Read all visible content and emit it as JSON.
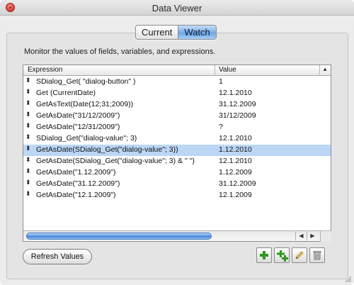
{
  "window": {
    "title": "Data Viewer"
  },
  "tabs": [
    {
      "label": "Current",
      "active": false
    },
    {
      "label": "Watch",
      "active": true
    }
  ],
  "description": "Monitor the values of fields, variables, and expressions.",
  "table": {
    "columns": [
      "Expression",
      "Value"
    ],
    "rows": [
      {
        "expression": "SDialog_Get( \"dialog-button\" )",
        "value": "1"
      },
      {
        "expression": "Get (CurrentDate)",
        "value": "12.1.2010"
      },
      {
        "expression": "GetAsText(Date(12;31;2009))",
        "value": "31.12.2009"
      },
      {
        "expression": "GetAsDate(\"31/12/2009\")",
        "value": "31/12/2009"
      },
      {
        "expression": "GetAsDate(\"12/31/2009\")",
        "value": "?"
      },
      {
        "expression": "SDialog_Get(\"dialog-value\"; 3)",
        "value": "12.1.2010"
      },
      {
        "expression": "GetAsDate(SDialog_Get(\"dialog-value\"; 3))",
        "value": "1.12.2010",
        "selected": true
      },
      {
        "expression": "GetAsDate(SDialog_Get(\"dialog-value\"; 3) & \" \")",
        "value": "12.1.2010"
      },
      {
        "expression": "GetAsDate(\"1.12.2009\")",
        "value": "1.12.2009"
      },
      {
        "expression": "GetAsDate(\"31.12.2009\")",
        "value": "31.12.2009"
      },
      {
        "expression": "GetAsDate(\"12.1.2009\")",
        "value": "12.1.2009"
      }
    ]
  },
  "buttons": {
    "refresh": "Refresh Values"
  },
  "toolbar_icons": [
    "add-icon",
    "duplicate-icon",
    "edit-pencil-icon",
    "delete-trash-icon"
  ],
  "colors": {
    "selection": "#bcd6f5",
    "accent": "#6aa2e6",
    "add_green": "#2e9a1e"
  }
}
